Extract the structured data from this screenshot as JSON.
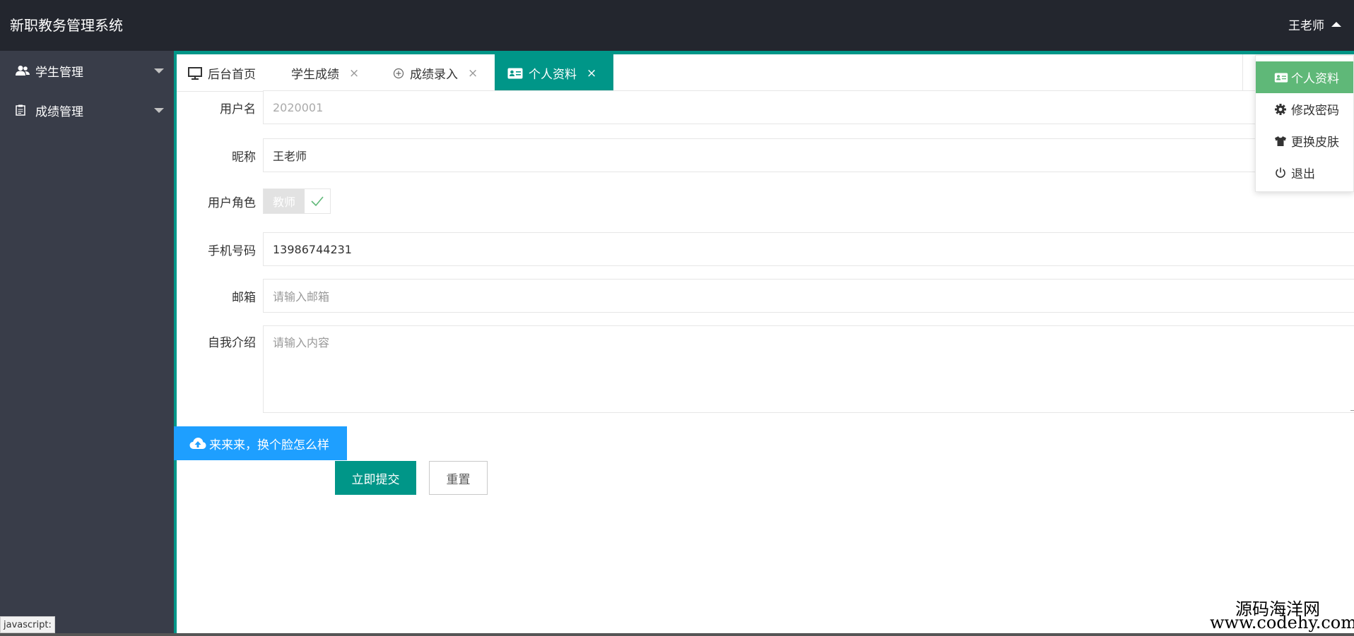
{
  "header": {
    "app_title": "新职教务管理系统",
    "user_name": "王老师"
  },
  "sidebar": {
    "items": [
      {
        "label": "学生管理"
      },
      {
        "label": "成绩管理"
      }
    ]
  },
  "tabs": [
    {
      "label": "后台首页",
      "closable": false
    },
    {
      "label": "学生成绩",
      "closable": true
    },
    {
      "label": "成绩录入",
      "closable": true
    },
    {
      "label": "个人资料",
      "closable": true,
      "active": true
    }
  ],
  "tab_close_glyph": "×",
  "form": {
    "username": {
      "label": "用户名",
      "value": "2020001"
    },
    "nickname": {
      "label": "昵称",
      "value": "王老师"
    },
    "role": {
      "label": "用户角色",
      "value": "教师",
      "checked": true
    },
    "phone": {
      "label": "手机号码",
      "value": "13986744231"
    },
    "email": {
      "label": "邮箱",
      "placeholder": "请输入邮箱"
    },
    "intro": {
      "label": "自我介绍",
      "placeholder": "请输入内容"
    }
  },
  "buttons": {
    "avatar": "来来来，换个脸怎么样",
    "submit": "立即提交",
    "reset": "重置"
  },
  "dropdown": {
    "items": [
      {
        "label": "个人资料",
        "icon": "id-card-icon",
        "active": true
      },
      {
        "label": "修改密码",
        "icon": "gear-icon"
      },
      {
        "label": "更换皮肤",
        "icon": "shirt-icon"
      },
      {
        "label": "退出",
        "icon": "power-icon"
      }
    ]
  },
  "status_bar": {
    "text": "javascript:"
  },
  "watermark": {
    "line1": "源码海洋网",
    "line2": "www.codehy.com"
  },
  "colors": {
    "header_bg": "#23262e",
    "sidebar_bg": "#393d49",
    "accent": "#009688",
    "blue": "#1e9fff",
    "dropdown_active": "#5fb878"
  }
}
